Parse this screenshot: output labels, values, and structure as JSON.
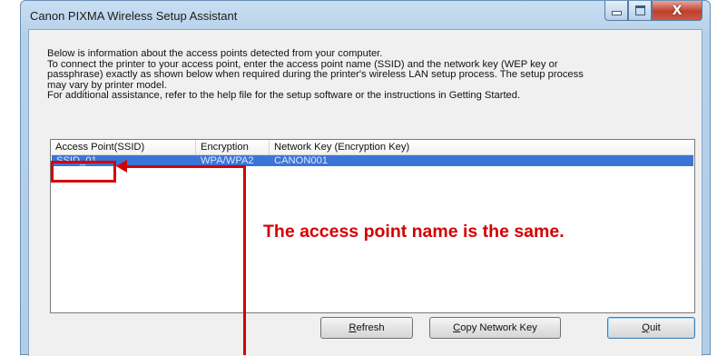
{
  "window": {
    "title": "Canon PIXMA Wireless Setup Assistant",
    "minimize_icon": "minimize-icon",
    "maximize_icon": "maximize-icon",
    "close_icon": "close-icon",
    "close_glyph": "X"
  },
  "info": {
    "lines": [
      "Below is information about the access points detected from your computer.",
      "To connect the printer to your access point, enter the access point name (SSID) and the network key (WEP key or",
      "passphrase) exactly as shown below when required during the printer's wireless LAN setup process. The setup process",
      "may vary by printer model.",
      "For additional assistance, refer to the help file for the setup software or the instructions in Getting Started."
    ]
  },
  "list": {
    "columns": [
      "Access Point(SSID)",
      "Encryption",
      "Network Key (Encryption Key)"
    ],
    "rows": [
      {
        "ssid": "SSID_01",
        "encryption": "WPA/WPA2",
        "key": "CANON001",
        "selected": true
      }
    ]
  },
  "buttons": {
    "refresh": {
      "before": "",
      "mnemonic": "R",
      "after": "efresh"
    },
    "copy": {
      "before": "",
      "mnemonic": "C",
      "after": "opy Network Key"
    },
    "quit": {
      "before": "",
      "mnemonic": "Q",
      "after": "uit"
    }
  },
  "annotation": {
    "note": "The access point name is the same.",
    "color": "#d40000"
  }
}
